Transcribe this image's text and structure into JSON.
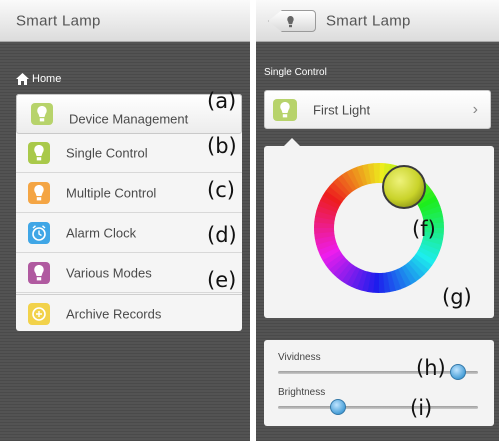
{
  "left_screen": {
    "title": "Smart Lamp",
    "breadcrumb": "Home",
    "menu": [
      {
        "label": "Device Management",
        "icon": "lamp-icon",
        "color": "#b7d36b",
        "annotation": "(a)"
      },
      {
        "label": "Single Control",
        "icon": "lamp-icon",
        "color": "#a9c94a",
        "annotation": "(b)"
      },
      {
        "label": "Multiple Control",
        "icon": "lamp-icon",
        "color": "#f4a544",
        "annotation": "(c)"
      },
      {
        "label": "Alarm Clock",
        "icon": "alarm-clock-icon",
        "color": "#3fa6e6",
        "annotation": "(d)"
      },
      {
        "label": "Various Modes",
        "icon": "lamp-icon",
        "color": "#b05aa0",
        "annotation": "(e)"
      },
      {
        "label": "Archive Records",
        "icon": "archive-icon",
        "color": "#f2d24a",
        "annotation": ""
      }
    ]
  },
  "right_screen": {
    "title": "Smart Lamp",
    "section_label": "Single Control",
    "light_item": {
      "label": "First Light",
      "color": "#b7d36b"
    },
    "color_wheel": {
      "selected_color": "#d7e03a",
      "annotation_picker": "(f)",
      "annotation_wheel": "(g)"
    },
    "sliders": [
      {
        "label": "Vividness",
        "value_fraction": 0.9,
        "annotation": "(h)"
      },
      {
        "label": "Brightness",
        "value_fraction": 0.3,
        "annotation": "(i)"
      }
    ]
  }
}
